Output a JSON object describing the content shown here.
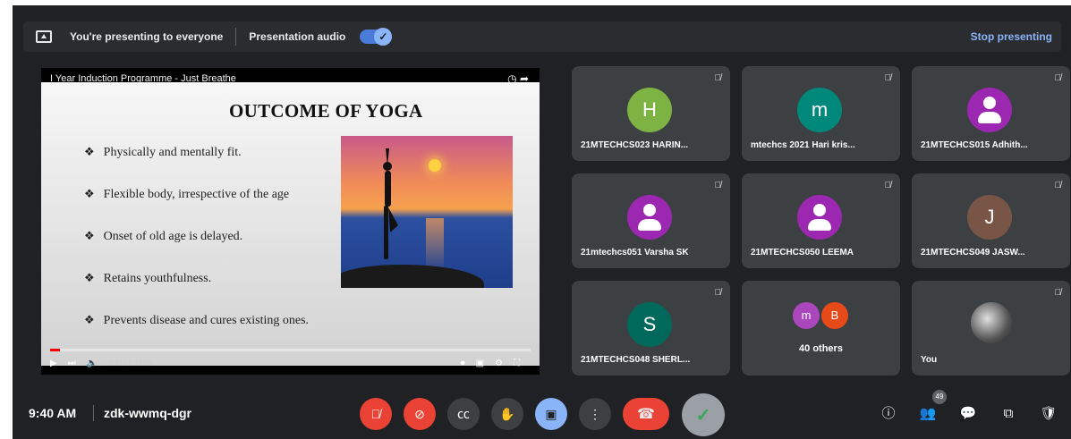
{
  "topbar": {
    "presenting_text": "You're presenting to everyone",
    "audio_label": "Presentation audio",
    "stop_label": "Stop presenting"
  },
  "presentation": {
    "video_title": "I Year Induction Programme - Just Breathe",
    "slide_title": "OUTCOME OF YOGA",
    "bullets": [
      "Physically and mentally fit.",
      "Flexible body, irrespective of the age",
      "Onset of old age is delayed.",
      "Retains youthfulness.",
      "Prevents disease and cures existing ones."
    ],
    "time": "2:17 / 1:19:19",
    "progress": 0.02
  },
  "participants": [
    {
      "initial": "H",
      "name": "21MTECHCS023 HARIN...",
      "color": "#7cb342"
    },
    {
      "initial": "m",
      "name": "mtechcs 2021 Hari kris...",
      "color": "#00897b"
    },
    {
      "initial": "",
      "name": "21MTECHCS015 Adhith...",
      "color": "#9c27b0"
    },
    {
      "initial": "",
      "name": "21mtechcs051 Varsha SK",
      "color": "#9c27b0"
    },
    {
      "initial": "",
      "name": "21MTECHCS050 LEEMA",
      "color": "#9c27b0"
    },
    {
      "initial": "J",
      "name": "21MTECHCS049 JASW...",
      "color": "#795548"
    },
    {
      "initial": "S",
      "name": "21MTECHCS048 SHERL...",
      "color": "#00695c"
    }
  ],
  "others": {
    "label": "40 others",
    "avatars": [
      {
        "initial": "m",
        "color": "#ab47bc"
      },
      {
        "initial": "B",
        "color": "#e64a19"
      }
    ]
  },
  "self": {
    "name": "You"
  },
  "bottom": {
    "time": "9:40 AM",
    "meeting_code": "zdk-wwmq-dgr",
    "participants_count": "49"
  }
}
